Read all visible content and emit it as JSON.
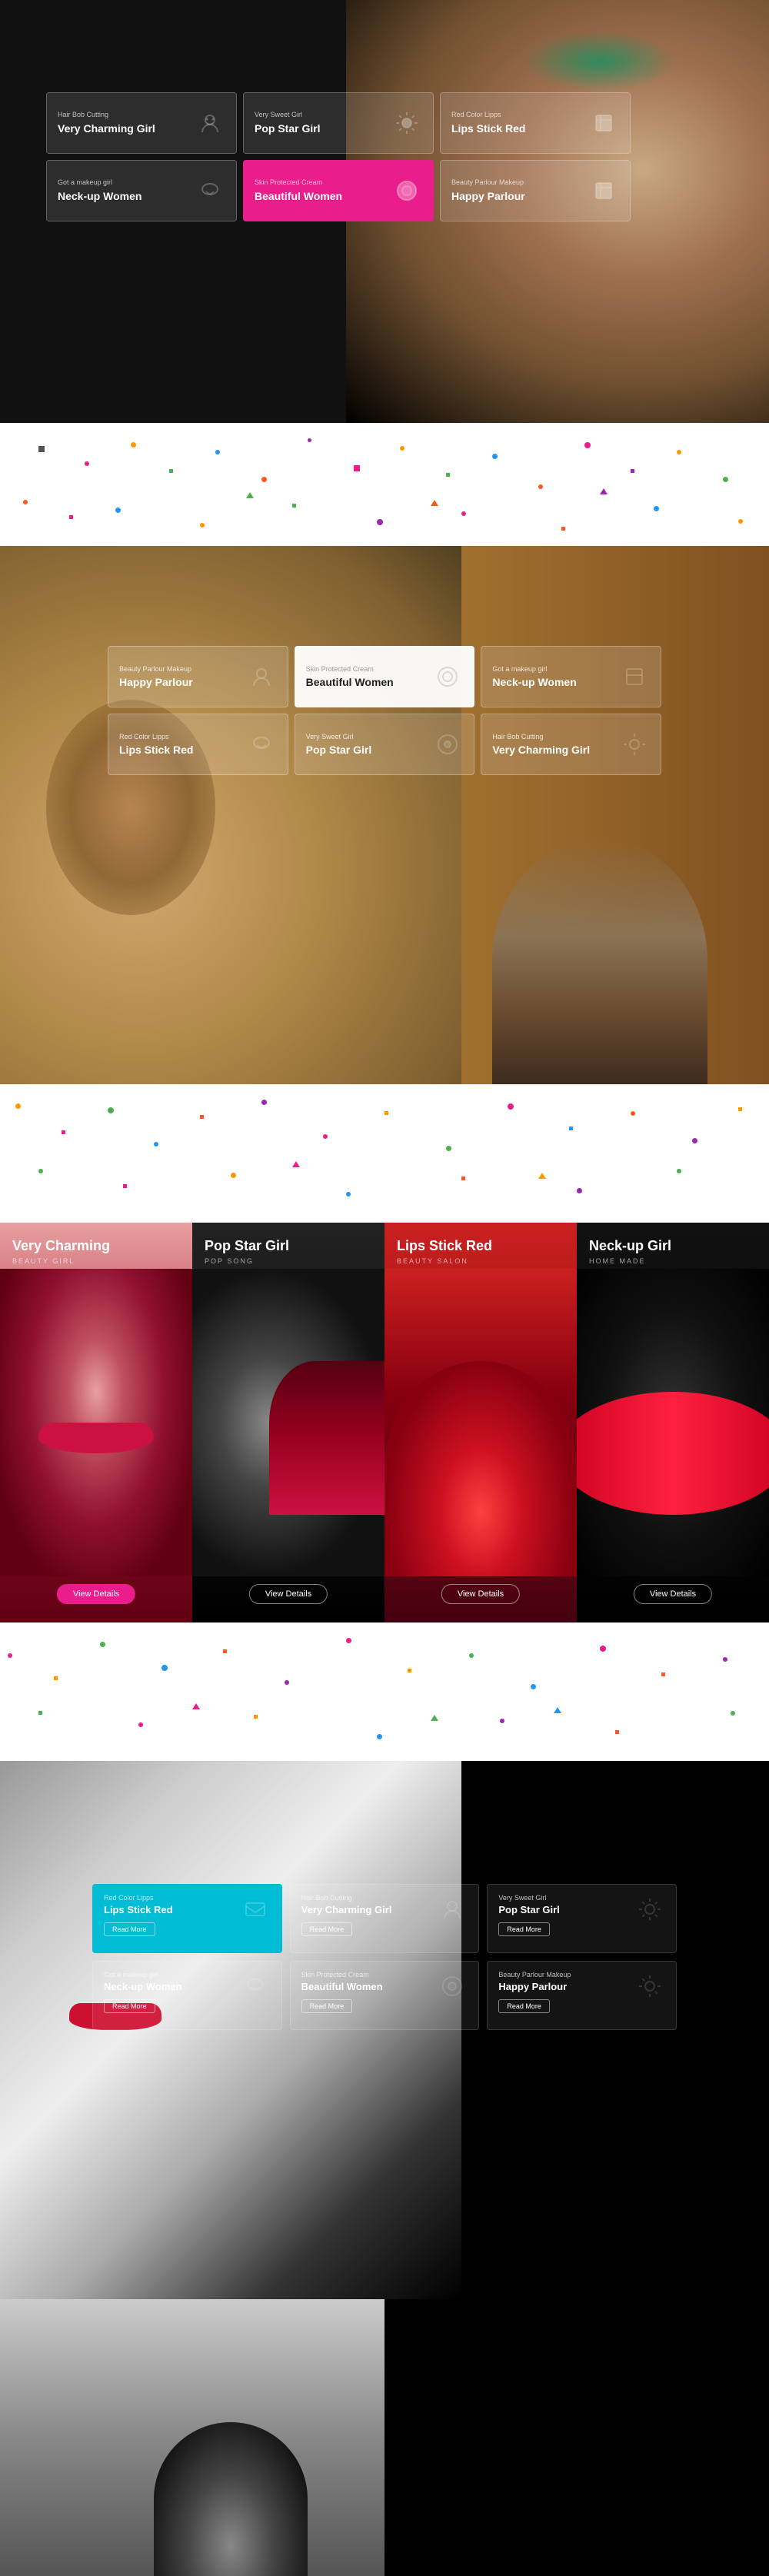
{
  "hero1": {
    "cards": [
      {
        "label": "Hair Bob Cutting",
        "title": "Very Charming Girl",
        "icon": "face",
        "active": false,
        "white": false
      },
      {
        "label": "Very Sweet Girl",
        "title": "Pop Star Girl",
        "icon": "gear",
        "active": false,
        "white": false
      },
      {
        "label": "Red Color Lipps",
        "title": "Lips Stick Red",
        "icon": "box",
        "active": false,
        "white": false
      },
      {
        "label": "Got a makeup girl",
        "title": "Neck-up Women",
        "icon": "smile",
        "active": false,
        "white": false
      },
      {
        "label": "Skin Protected Cream",
        "title": "Beautiful Women",
        "icon": "circle",
        "active": true,
        "white": false
      },
      {
        "label": "Beauty Parlour Makeup",
        "title": "Happy Parlour",
        "icon": "pkg",
        "active": false,
        "white": false
      }
    ]
  },
  "hero2": {
    "cards": [
      {
        "label": "Beauty Parlour Makeup",
        "title": "Happy Parlour",
        "icon": "face",
        "white": false
      },
      {
        "label": "Skin Protected Cream",
        "title": "Beautiful Women",
        "icon": "circle",
        "white": true
      },
      {
        "label": "Got a makeup girl",
        "title": "Neck-up Women",
        "icon": "box",
        "white": false
      },
      {
        "label": "Red Color Lipps",
        "title": "Lips Stick Red",
        "icon": "smile",
        "white": false
      },
      {
        "label": "Very Sweet Girl",
        "title": "Pop Star Girl",
        "icon": "circle",
        "white": false
      },
      {
        "label": "Hair Bob Cutting",
        "title": "Very Charming Girl",
        "icon": "gear",
        "white": false
      }
    ]
  },
  "products": [
    {
      "title": "Very Charming",
      "subtitle": "BEAUTY GIRL",
      "btnLabel": "View Details",
      "btnPink": true,
      "bgClass": "card-pink-bg"
    },
    {
      "title": "Pop Star Girl",
      "subtitle": "POP SONG",
      "btnLabel": "View Details",
      "btnPink": false,
      "bgClass": "card-dark-bg"
    },
    {
      "title": "Lips Stick Red",
      "subtitle": "BEAUTY SALON",
      "btnLabel": "View Details",
      "btnPink": false,
      "bgClass": "card-red-bg"
    },
    {
      "title": "Neck-up Girl",
      "subtitle": "HOME MADE",
      "btnLabel": "View Details",
      "btnPink": false,
      "bgClass": "card-black-bg"
    }
  ],
  "hero3": {
    "cards": [
      {
        "label": "Red Color Lipps",
        "title": "Lips Stick Red",
        "icon": "mail",
        "cyan": true
      },
      {
        "label": "Hair Bob Cutting",
        "title": "Very Charming Girl",
        "icon": "face",
        "cyan": false
      },
      {
        "label": "Very Sweet Girl",
        "title": "Pop Star Girl",
        "icon": "gear",
        "cyan": false
      },
      {
        "label": "Got a makeup girl",
        "title": "Neck-up Women",
        "icon": "smile",
        "cyan": false
      },
      {
        "label": "Skin Protected Cream",
        "title": "Beautiful Women",
        "icon": "circle",
        "cyan": false
      },
      {
        "label": "Beauty Parlour Makeup",
        "title": "Happy Parlour",
        "icon": "gear2",
        "cyan": false
      }
    ],
    "readMoreLabel": "Read More"
  }
}
